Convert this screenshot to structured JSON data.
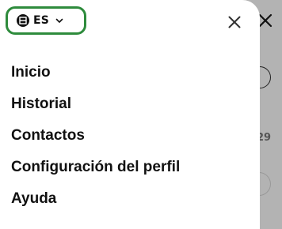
{
  "language_selector": {
    "code": "ES",
    "icon": "flag-circle-icon",
    "accent_color": "#2e8b3c"
  },
  "close_icon": "close-icon",
  "menu": {
    "items": [
      {
        "label": "Inicio"
      },
      {
        "label": "Historial"
      },
      {
        "label": "Contactos"
      },
      {
        "label": "Configuración del perfil"
      },
      {
        "label": "Ayuda"
      }
    ]
  },
  "background": {
    "number_text": "29"
  }
}
